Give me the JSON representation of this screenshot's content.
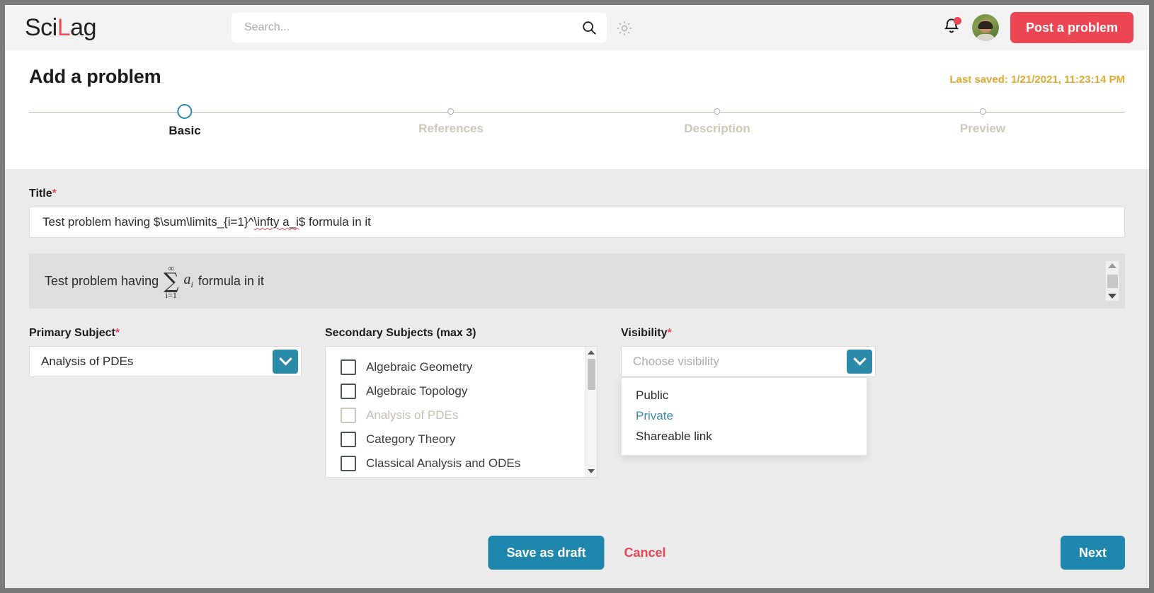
{
  "brand": {
    "name_part1": "Sci",
    "name_accent": "L",
    "name_part2": "ag"
  },
  "header": {
    "search_placeholder": "Search...",
    "search_value": "",
    "post_button": "Post a problem",
    "notification_present": true
  },
  "page": {
    "title": "Add a problem",
    "last_saved": "Last saved: 1/21/2021, 11:23:14 PM"
  },
  "stepper": {
    "steps": [
      {
        "label": "Basic",
        "active": true
      },
      {
        "label": "References",
        "active": false
      },
      {
        "label": "Description",
        "active": false
      },
      {
        "label": "Preview",
        "active": false
      }
    ]
  },
  "form": {
    "title_label": "Title",
    "title_value": "Test problem having $\\sum\\limits_{i=1}^\\infty a_i$ formula in it",
    "title_value_prefix": "Test problem having $\\sum\\limits_{i=1}^",
    "title_value_squiggle": "\\infty a_i",
    "title_value_suffix": "$ formula in it",
    "preview": {
      "text_before": "Test problem having",
      "sum_upper": "∞",
      "sum_symbol": "∑",
      "sum_lower": "i=1",
      "term": "a",
      "term_sub": "i",
      "text_after": "formula in it"
    },
    "primary_subject_label": "Primary Subject",
    "primary_subject_value": "Analysis of PDEs",
    "secondary_subjects_label": "Secondary Subjects (max 3)",
    "secondary_subjects": [
      {
        "label": "Algebraic Geometry",
        "checked": false,
        "disabled": false
      },
      {
        "label": "Algebraic Topology",
        "checked": false,
        "disabled": false
      },
      {
        "label": "Analysis of PDEs",
        "checked": false,
        "disabled": true
      },
      {
        "label": "Category Theory",
        "checked": false,
        "disabled": false
      },
      {
        "label": "Classical Analysis and ODEs",
        "checked": false,
        "disabled": false
      }
    ],
    "visibility_label": "Visibility",
    "visibility_placeholder": "Choose visibility",
    "visibility_value": "",
    "visibility_options": [
      {
        "label": "Public",
        "selected": false
      },
      {
        "label": "Private",
        "selected": true
      },
      {
        "label": "Shareable link",
        "selected": false
      }
    ],
    "required_marker": "*"
  },
  "footer": {
    "save_draft": "Save as draft",
    "cancel": "Cancel",
    "next": "Next"
  },
  "colors": {
    "brand_red": "#ec4653",
    "accent_teal": "#1f87ad",
    "select_caret": "#2a8aa8",
    "gold": "#dda92f",
    "required": "#e0485a",
    "step_inactive": "#cdc7b8"
  }
}
